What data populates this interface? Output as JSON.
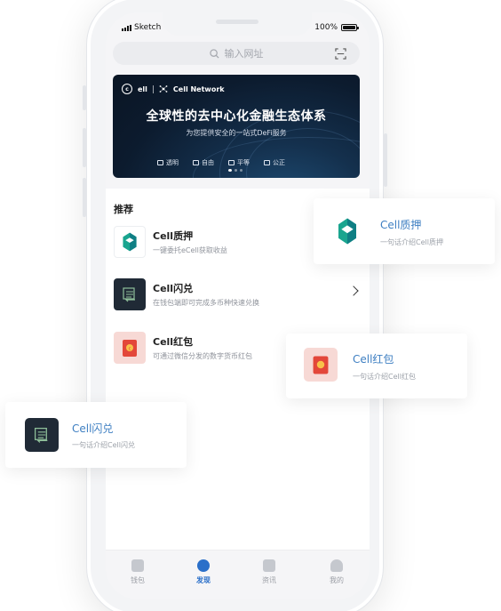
{
  "status_bar": {
    "carrier": "Sketch",
    "battery": "100%"
  },
  "search": {
    "placeholder": "输入网址"
  },
  "banner": {
    "brand_left": "ell",
    "brand_right": "Cell Network",
    "title": "全球性的去中心化金融生态体系",
    "subtitle": "为您提供安全的一站式DeFi服务",
    "features": [
      "透明",
      "自由",
      "平等",
      "公正"
    ]
  },
  "section": {
    "title": "推荐"
  },
  "items": [
    {
      "name": "Cell质押",
      "desc": "一键委托eCell获取收益"
    },
    {
      "name": "Cell闪兑",
      "desc": "在钱包端即可完成多币种快速兑换"
    },
    {
      "name": "Cell红包",
      "desc": "可通过微信分发的数字货币红包"
    }
  ],
  "tabs": [
    {
      "label": "钱包"
    },
    {
      "label": "发现"
    },
    {
      "label": "资讯"
    },
    {
      "label": "我的"
    }
  ],
  "cards": [
    {
      "name": "Cell质押",
      "desc": "一句话介绍Cell质押"
    },
    {
      "name": "Cell红包",
      "desc": "一句话介绍Cell红包"
    },
    {
      "name": "Cell闪兑",
      "desc": "一句话介绍Cell闪兑"
    }
  ],
  "colors": {
    "accent": "#2a6fc9",
    "card_title": "#3e7fc2",
    "pledge_green": "#1aa58f",
    "red_packet": "#e3473a"
  }
}
